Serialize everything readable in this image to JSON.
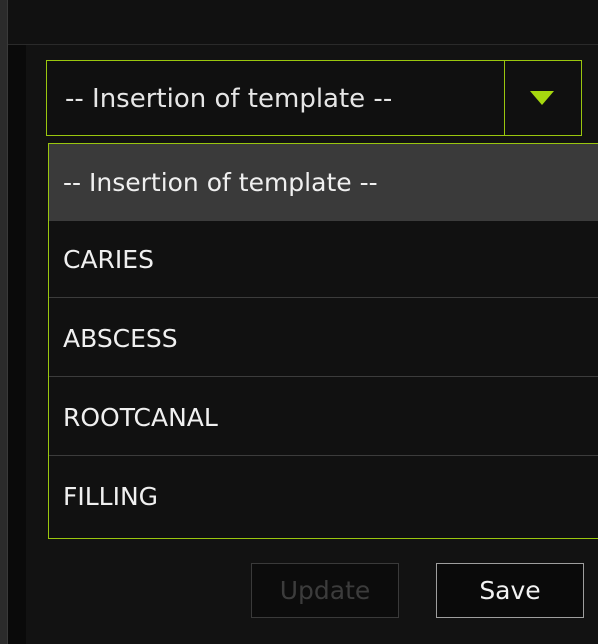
{
  "combo": {
    "selected_value": "-- Insertion of template --",
    "arrow_icon": "triangle-down-icon"
  },
  "dropdown": {
    "options": [
      {
        "label": "-- Insertion of template --",
        "selected": true
      },
      {
        "label": "CARIES",
        "selected": false
      },
      {
        "label": "ABSCESS",
        "selected": false
      },
      {
        "label": "ROOTCANAL",
        "selected": false
      },
      {
        "label": "FILLING",
        "selected": false
      }
    ]
  },
  "buttons": {
    "update_label": "Update",
    "update_disabled": true,
    "save_label": "Save"
  },
  "colors": {
    "accent": "#9ac60e",
    "arrow": "#a6d80f",
    "background": "#0a0a0a",
    "selected_option": "#3a3a3a",
    "disabled_text": "#3c3c3c"
  }
}
